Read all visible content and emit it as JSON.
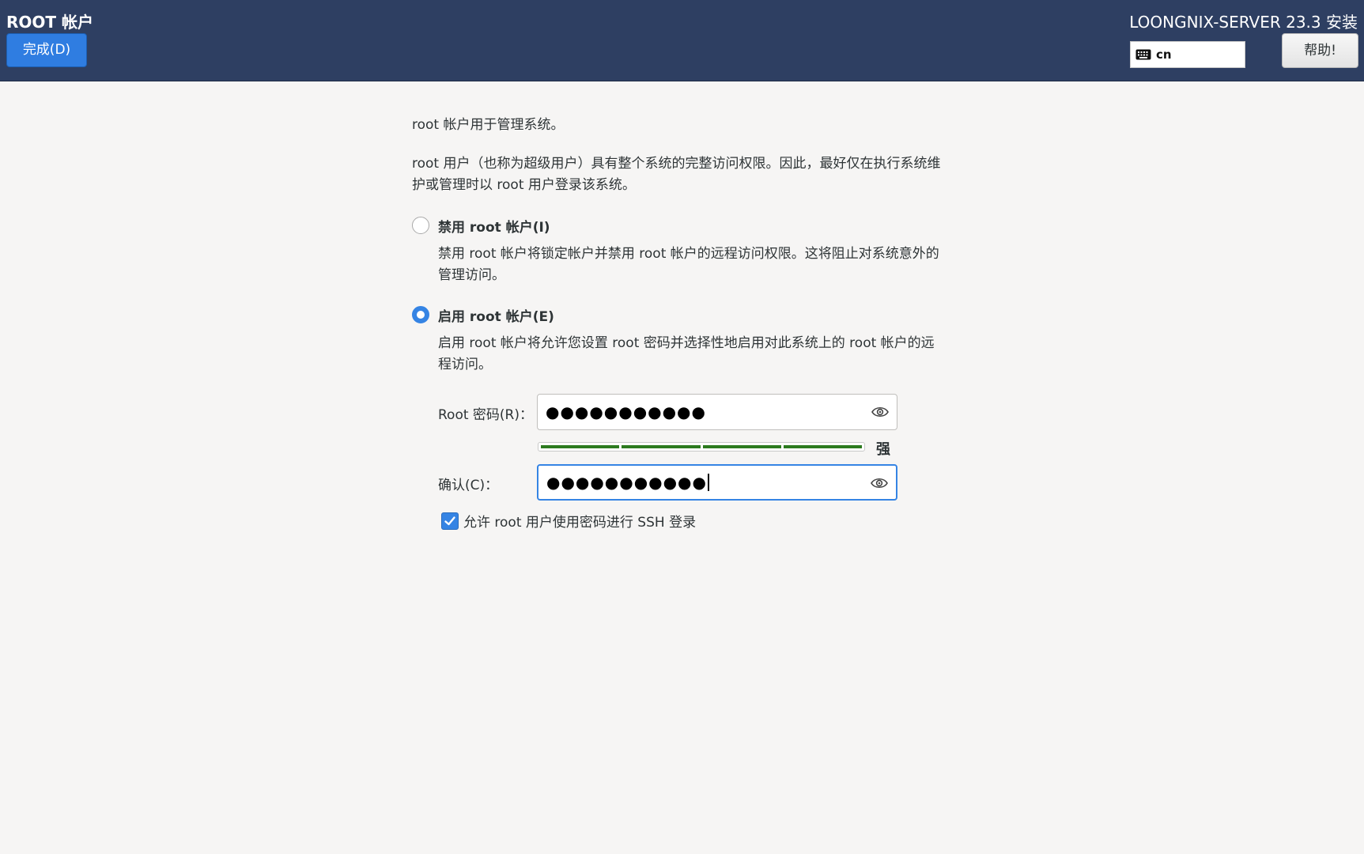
{
  "header": {
    "page_title": "ROOT 帐户",
    "done_label": "完成(D)",
    "product_title": "LOONGNIX-SERVER 23.3 安装",
    "keyboard_layout": "cn",
    "help_label": "帮助!"
  },
  "intro": {
    "line1": "root 帐户用于管理系统。",
    "line2a": "root 用户（也称为超级用户）具有整个系统的完整访问权限。因此，最好仅在执行系统维",
    "line2b": "护或管理时以 root 用户登录该系统。"
  },
  "options": {
    "disable": {
      "label": "禁用 root 帐户(I)",
      "desc_a": "禁用 root 帐户将锁定帐户并禁用 root 帐户的远程访问权限。这将阻止对系统意外的",
      "desc_b": "管理访问。",
      "selected": false
    },
    "enable": {
      "label": "启用 root 帐户(E)",
      "desc_a": "启用 root 帐户将允许您设置 root 密码并选择性地启用对此系统上的 root 帐户的远",
      "desc_b": "程访问。",
      "selected": true
    }
  },
  "password": {
    "label": "Root 密码(R)：",
    "value": "●●●●●●●●●●●",
    "strength_label": "强",
    "strength_level": 4,
    "strength_max": 4
  },
  "confirm": {
    "label": "确认(C)：",
    "value": "●●●●●●●●●●●"
  },
  "ssh": {
    "label": "允许 root 用户使用密码进行 SSH 登录",
    "checked": true
  },
  "icons": {
    "keyboard": "keyboard-icon",
    "eye": "eye-icon",
    "check": "checkmark-icon"
  },
  "colors": {
    "header_bg": "#2e3f62",
    "accent": "#3584e4",
    "strength": "#2c7a1e"
  }
}
